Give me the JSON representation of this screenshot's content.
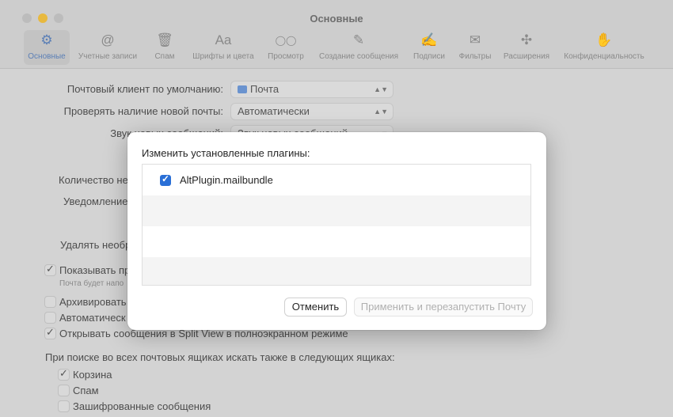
{
  "window": {
    "title": "Основные"
  },
  "toolbar": {
    "items": [
      {
        "label": "Основные",
        "icon": "gear-icon",
        "glyph": "⚙"
      },
      {
        "label": "Учетные записи",
        "icon": "at-icon",
        "glyph": "@"
      },
      {
        "label": "Спам",
        "icon": "junk-tray-icon",
        "glyph": "🗑"
      },
      {
        "label": "Шрифты и цвета",
        "icon": "font-icon",
        "glyph": "Aa"
      },
      {
        "label": "Просмотр",
        "icon": "glasses-icon",
        "glyph": "◯◯"
      },
      {
        "label": "Создание сообщения",
        "icon": "compose-icon",
        "glyph": "✎"
      },
      {
        "label": "Подписи",
        "icon": "signature-icon",
        "glyph": "✍"
      },
      {
        "label": "Фильтры",
        "icon": "filter-mail-icon",
        "glyph": "✉"
      },
      {
        "label": "Расширения",
        "icon": "puzzle-icon",
        "glyph": "✣"
      },
      {
        "label": "Конфиденциальность",
        "icon": "hand-icon",
        "glyph": "✋"
      }
    ]
  },
  "settings": {
    "default_client_label": "Почтовый клиент по умолчанию:",
    "default_client_value": "Почта",
    "check_mail_label": "Проверять наличие новой почты:",
    "check_mail_value": "Автоматически",
    "sound_label": "Звук новых сообщений:",
    "sound_value": "Звук новых сообщений",
    "unread_count_label": "Количество не",
    "notification_label": "Уведомление",
    "remove_label": "Удалять необр",
    "show_label": "Показывать пр",
    "show_note": "Почта будет напо",
    "archive_label": "Архивировать",
    "auto_label": "Автоматическ",
    "split_view_label": "Открывать сообщения в Split View в полноэкранном режиме",
    "search_label": "При поиске во всех почтовых ящиках искать также в следующих ящиках:",
    "trash_label": "Корзина",
    "junk_label": "Спам",
    "encrypted_label": "Зашифрованные сообщения"
  },
  "dialog": {
    "title": "Изменить установленные плагины:",
    "plugins": [
      {
        "name": "AltPlugin.mailbundle",
        "checked": true
      }
    ],
    "cancel_label": "Отменить",
    "apply_label": "Применить и перезапустить Почту"
  }
}
